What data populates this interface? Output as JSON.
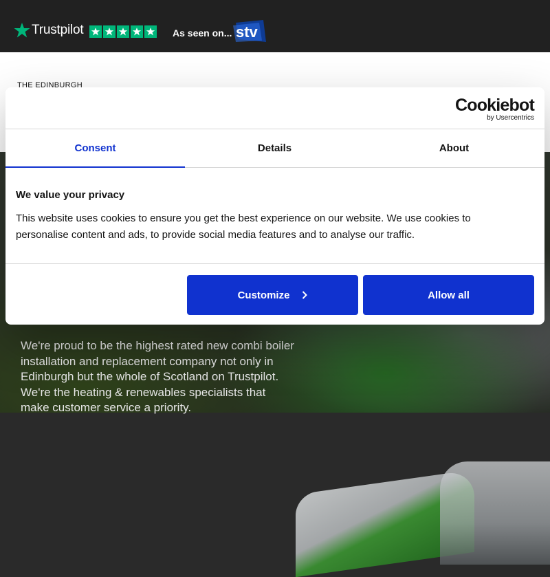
{
  "topbar": {
    "trustpilot_label": "Trustpilot",
    "rating_stars": 5,
    "as_seen_on": "As seen on...",
    "stv_label": "stv"
  },
  "header": {
    "brand_line": "THE EDINBURGH"
  },
  "hero": {
    "text": "We're proud to be the highest rated new combi boiler installation and replacement company not only in Edinburgh but the whole of Scotland on Trustpilot. We're the heating & renewables specialists that make customer service a priority."
  },
  "dialog": {
    "logo_main": "Cookiebot",
    "logo_sub": "by Usercentrics",
    "tabs": [
      {
        "label": "Consent",
        "active": true
      },
      {
        "label": "Details",
        "active": false
      },
      {
        "label": "About",
        "active": false
      }
    ],
    "title": "We value your privacy",
    "body": "This website uses cookies to ensure you get the best experience on our website. We use cookies to personalise content and ads, to provide social media features and to analyse our traffic.",
    "customize_label": "Customize",
    "allow_all_label": "Allow all"
  },
  "colors": {
    "accent": "#1032cf",
    "trustpilot_green": "#00b67a",
    "topbar_bg": "#212121"
  },
  "icons": [
    "trustpilot-star-icon",
    "stv-logo-icon",
    "chevron-right-icon"
  ]
}
